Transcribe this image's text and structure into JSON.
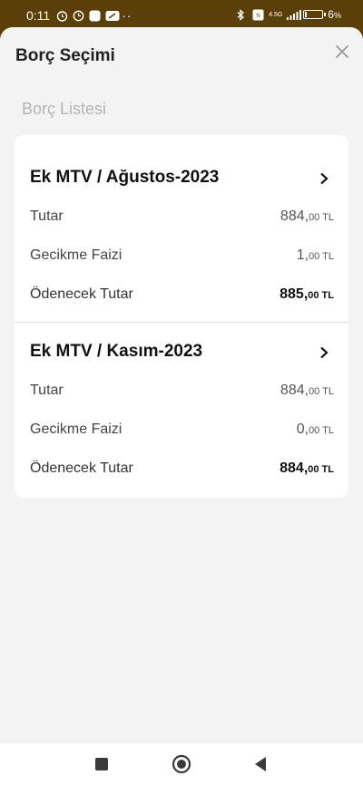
{
  "status_bar": {
    "time": "0:11",
    "battery_percent": "6",
    "network": "4.5G"
  },
  "sheet": {
    "title": "Borç Seçimi",
    "close_icon": "close-icon",
    "section_label": "Borç Listesi"
  },
  "debts": [
    {
      "title": "Ek MTV / Ağustos-2023",
      "rows": [
        {
          "label": "Tutar",
          "int": "884,",
          "dec": "00 TL"
        },
        {
          "label": "Gecikme Faizi",
          "int": "1,",
          "dec": "00 TL"
        },
        {
          "label": "Ödenecek Tutar",
          "int": "885,",
          "dec": "00 TL"
        }
      ]
    },
    {
      "title": "Ek MTV / Kasım-2023",
      "rows": [
        {
          "label": "Tutar",
          "int": "884,",
          "dec": "00 TL"
        },
        {
          "label": "Gecikme Faizi",
          "int": "0,",
          "dec": "00 TL"
        },
        {
          "label": "Ödenecek Tutar",
          "int": "884,",
          "dec": "00 TL"
        }
      ]
    }
  ],
  "nav": {
    "recents": "square-icon",
    "home": "circle-icon",
    "back": "triangle-back-icon"
  },
  "colors": {
    "status_bar": "#5a4008",
    "sheet_bg": "#f3f3f3",
    "card_bg": "#ffffff"
  }
}
